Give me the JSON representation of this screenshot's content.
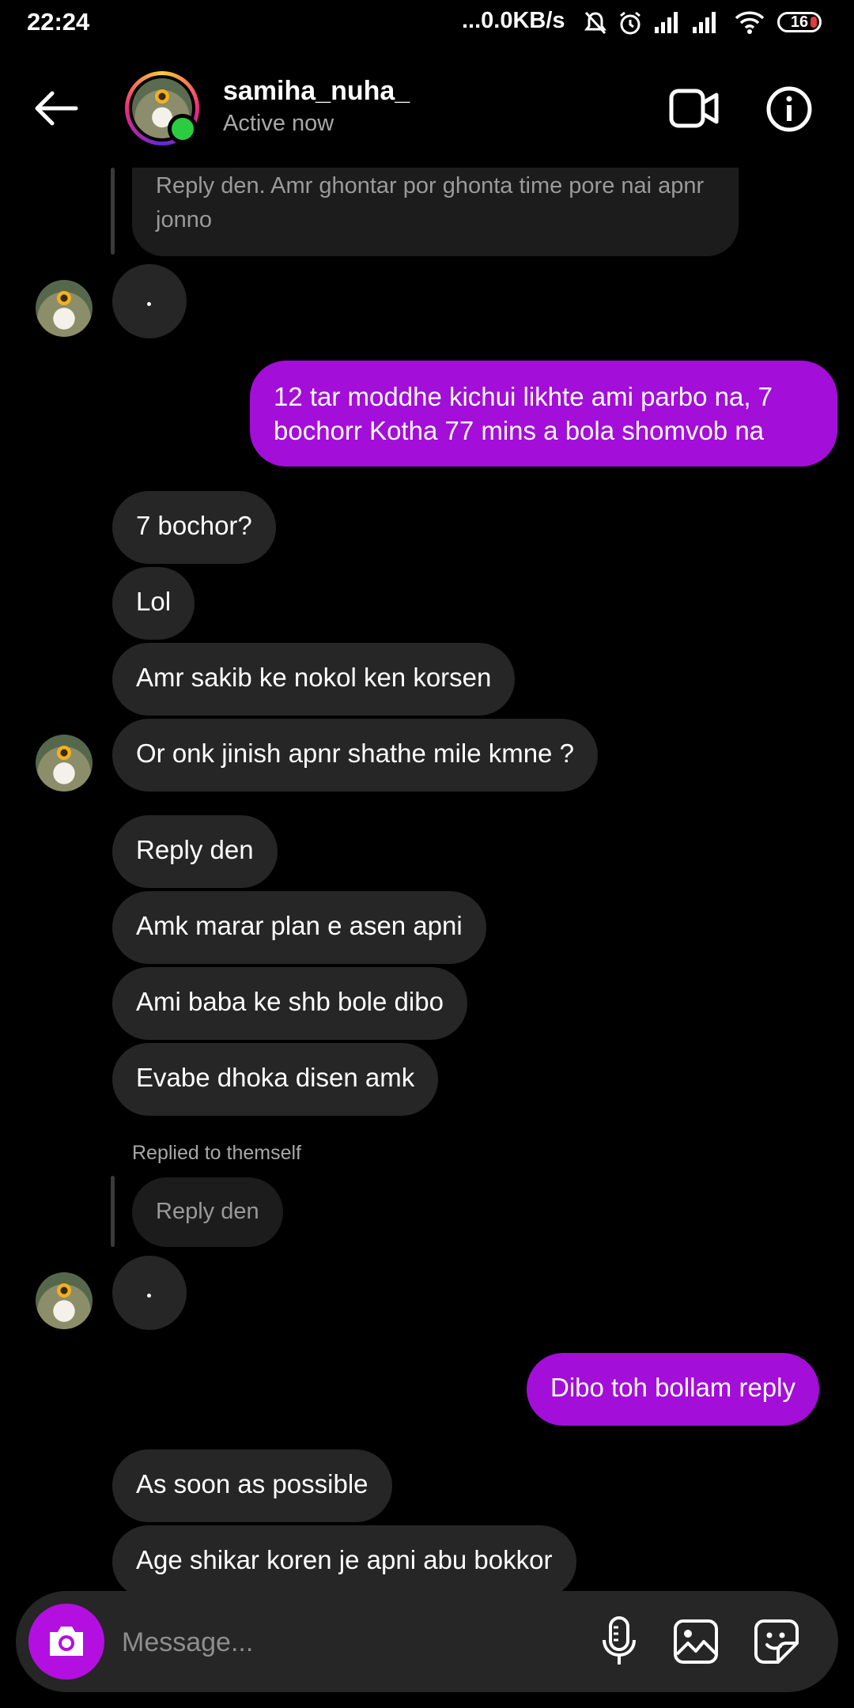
{
  "status_bar": {
    "time": "22:24",
    "network_speed": "...0.0KB/s",
    "battery_level": "16",
    "icons": [
      "mute-icon",
      "alarm-icon",
      "signal-icon",
      "signal-icon",
      "wifi-icon",
      "battery-icon"
    ]
  },
  "header": {
    "username": "samiha_nuha_",
    "status": "Active now",
    "icons": [
      "back-arrow-icon",
      "video-call-icon",
      "info-icon"
    ]
  },
  "messages": [
    {
      "type": "reply-quote",
      "text": "Reply den. Amr ghontar por ghonta time pore nai apnr jonno"
    },
    {
      "type": "incoming",
      "text": "."
    },
    {
      "type": "outgoing",
      "text": "12 tar moddhe kichui likhte ami parbo na, 7 bochorr Kotha 77 mins a bola shomvob na"
    },
    {
      "type": "incoming",
      "text": "7 bochor?"
    },
    {
      "type": "incoming",
      "text": "Lol"
    },
    {
      "type": "incoming",
      "text": "Amr sakib ke nokol ken korsen"
    },
    {
      "type": "incoming",
      "text": "Or onk jinish apnr shathe mile kmne ?"
    },
    {
      "type": "incoming",
      "text": "Reply den"
    },
    {
      "type": "incoming",
      "text": "Amk marar plan e asen apni"
    },
    {
      "type": "incoming",
      "text": "Ami baba ke shb bole dibo"
    },
    {
      "type": "incoming",
      "text": "Evabe dhoka disen amk"
    },
    {
      "type": "replied-label",
      "text": "Replied to themself"
    },
    {
      "type": "reply-quote",
      "text": "Reply den"
    },
    {
      "type": "incoming",
      "text": "."
    },
    {
      "type": "outgoing",
      "text": "Dibo toh bollam reply"
    },
    {
      "type": "incoming",
      "text": "As soon as possible"
    },
    {
      "type": "incoming",
      "text": "Age shikar koren je apni abu bokkor"
    }
  ],
  "composer": {
    "placeholder": "Message...",
    "icons": [
      "camera-icon",
      "microphone-icon",
      "gallery-icon",
      "sticker-icon"
    ]
  },
  "colors": {
    "background": "#000000",
    "incoming_bubble": "#262626",
    "outgoing_bubble": "#a30ed8",
    "online_dot": "#2bcc40",
    "camera_button": "#b30fe0"
  }
}
